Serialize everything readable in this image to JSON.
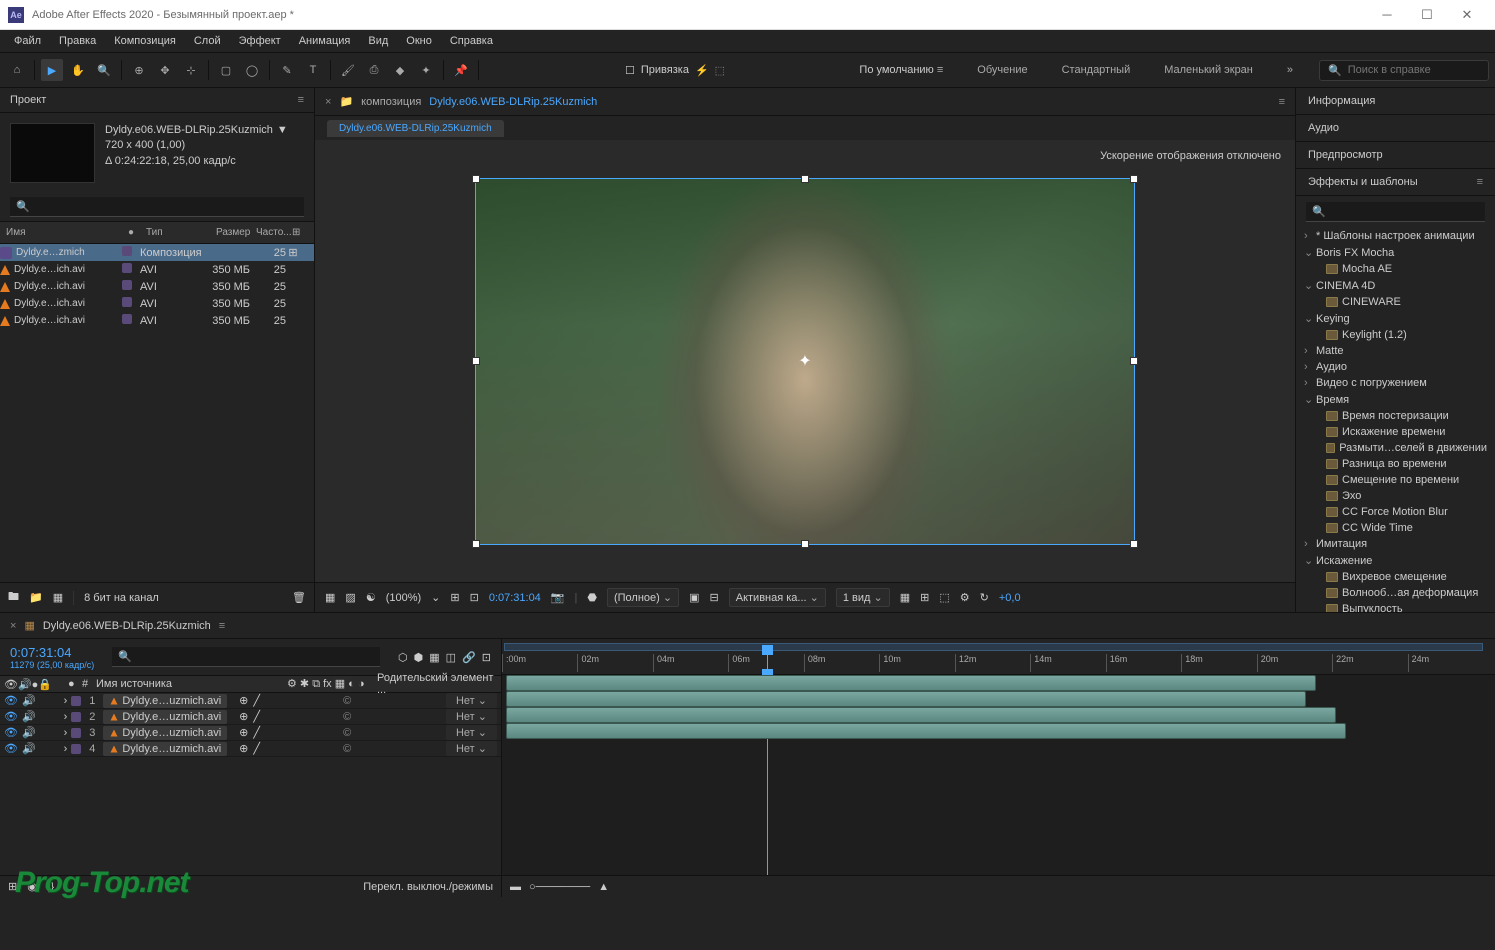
{
  "window": {
    "title": "Adobe After Effects 2020 - Безымянный проект.aep *",
    "logo": "Ae"
  },
  "menu": [
    "Файл",
    "Правка",
    "Композиция",
    "Слой",
    "Эффект",
    "Анимация",
    "Вид",
    "Окно",
    "Справка"
  ],
  "toolbar": {
    "snap_label": "Привязка",
    "workspaces": {
      "active": "По умолчанию",
      "items": [
        "Обучение",
        "Стандартный",
        "Маленький экран"
      ]
    },
    "search_placeholder": "Поиск в справке"
  },
  "project": {
    "tab": "Проект",
    "comp_name": "Dyldy.e06.WEB-DLRip.25Kuzmich",
    "dims": "720 x 400 (1,00)",
    "duration": "Δ 0:24:22:18, 25,00 кадр/с",
    "columns": {
      "name": "Имя",
      "type": "Тип",
      "size": "Размер",
      "freq": "Часто..."
    },
    "rows": [
      {
        "name": "Dyldy.e…zmich",
        "type": "Композиция",
        "size": "",
        "freq": "25",
        "kind": "comp"
      },
      {
        "name": "Dyldy.e…ich.avi",
        "type": "AVI",
        "size": "350 МБ",
        "freq": "25",
        "kind": "avi"
      },
      {
        "name": "Dyldy.e…ich.avi",
        "type": "AVI",
        "size": "350 МБ",
        "freq": "25",
        "kind": "avi"
      },
      {
        "name": "Dyldy.e…ich.avi",
        "type": "AVI",
        "size": "350 МБ",
        "freq": "25",
        "kind": "avi"
      },
      {
        "name": "Dyldy.e…ich.avi",
        "type": "AVI",
        "size": "350 МБ",
        "freq": "25",
        "kind": "avi"
      }
    ],
    "footer_bits": "8 бит на канал"
  },
  "viewer": {
    "prefix": "композиция",
    "name": "Dyldy.e06.WEB-DLRip.25Kuzmich",
    "subtab": "Dyldy.e06.WEB-DLRip.25Kuzmich",
    "accel_msg": "Ускорение отображения отключено",
    "zoom": "(100%)",
    "timecode": "0:07:31:04",
    "quality": "(Полное)",
    "camera": "Активная ка...",
    "views": "1 вид",
    "exposure": "+0,0"
  },
  "panels": {
    "info": "Информация",
    "audio": "Аудио",
    "preview": "Предпросмотр",
    "fx": "Эффекты и шаблоны"
  },
  "fx_tree": [
    {
      "t": "cat",
      "open": false,
      "label": "* Шаблоны настроек анимации"
    },
    {
      "t": "cat",
      "open": true,
      "label": "Boris FX Mocha"
    },
    {
      "t": "leaf",
      "label": "Mocha AE"
    },
    {
      "t": "cat",
      "open": true,
      "label": "CINEMA 4D"
    },
    {
      "t": "leaf",
      "label": "CINEWARE"
    },
    {
      "t": "cat",
      "open": true,
      "label": "Keying"
    },
    {
      "t": "leaf",
      "label": "Keylight (1.2)"
    },
    {
      "t": "cat",
      "open": false,
      "label": "Matte"
    },
    {
      "t": "cat",
      "open": false,
      "label": "Аудио"
    },
    {
      "t": "cat",
      "open": false,
      "label": "Видео с погружением"
    },
    {
      "t": "cat",
      "open": true,
      "label": "Время"
    },
    {
      "t": "leaf",
      "label": "Время постеризации"
    },
    {
      "t": "leaf",
      "label": "Искажение времени"
    },
    {
      "t": "leaf",
      "label": "Размыти…селей в движении"
    },
    {
      "t": "leaf",
      "label": "Разница во времени"
    },
    {
      "t": "leaf",
      "label": "Смещение по времени"
    },
    {
      "t": "leaf",
      "label": "Эхо"
    },
    {
      "t": "leaf",
      "label": "CC Force Motion Blur"
    },
    {
      "t": "leaf",
      "label": "CC Wide Time"
    },
    {
      "t": "cat",
      "open": false,
      "label": "Имитация"
    },
    {
      "t": "cat",
      "open": true,
      "label": "Искажение"
    },
    {
      "t": "leaf",
      "label": "Вихревое смещение"
    },
    {
      "t": "leaf",
      "label": "Волнооб…ая деформация"
    },
    {
      "t": "leaf",
      "label": "Выпуклость"
    }
  ],
  "timeline": {
    "tab": "Dyldy.e06.WEB-DLRip.25Kuzmich",
    "timecode": "0:07:31:04",
    "frames": "11279 (25,00 кадр/с)",
    "col_source": "Имя источника",
    "col_parent": "Родительский элемент ...",
    "parent_none": "Нет",
    "layers": [
      {
        "n": 1,
        "name": "Dyldy.e…uzmich.avi"
      },
      {
        "n": 2,
        "name": "Dyldy.e…uzmich.avi"
      },
      {
        "n": 3,
        "name": "Dyldy.e…uzmich.avi"
      },
      {
        "n": 4,
        "name": "Dyldy.e…uzmich.avi"
      }
    ],
    "ticks": [
      ":00m",
      "02m",
      "04m",
      "06m",
      "08m",
      "10m",
      "12m",
      "14m",
      "16m",
      "18m",
      "20m",
      "22m",
      "24m"
    ],
    "footer": "Перекл. выключ./режимы"
  },
  "watermark": "Prog-Top.net"
}
